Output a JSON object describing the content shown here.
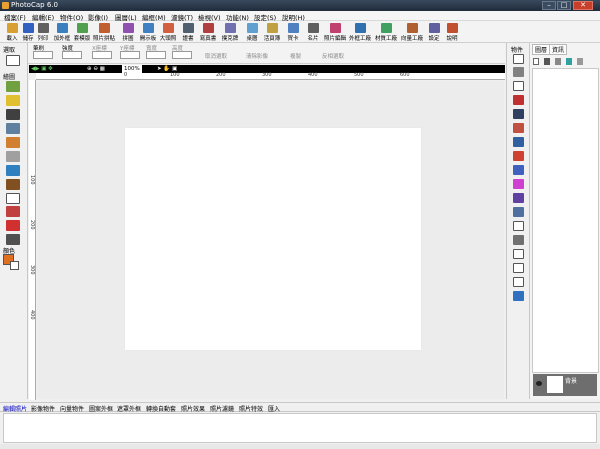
{
  "window": {
    "title": "PhotoCap 6.0",
    "minimize": "–",
    "maximize": "□",
    "close": "✕"
  },
  "menu": [
    "檔案(F)",
    "編輯(E)",
    "物件(O)",
    "影像(I)",
    "圖層(L)",
    "編框(M)",
    "濾鏡(T)",
    "檢視(V)",
    "功能(N)",
    "設定(S)",
    "說明(H)"
  ],
  "toolbar": [
    {
      "label": "載入",
      "color": "#d8a030"
    },
    {
      "label": "儲存",
      "color": "#3060c0"
    },
    {
      "label": "列印",
      "color": "#606060"
    },
    {
      "label": "加外框",
      "color": "#3a80c0"
    },
    {
      "label": "套模版",
      "color": "#50a050"
    },
    {
      "label": "照片拼貼",
      "color": "#c06030"
    },
    {
      "label": "拼圖",
      "color": "#9050b0"
    },
    {
      "label": "開示板",
      "color": "#4080c0"
    },
    {
      "label": "大頭照",
      "color": "#d06040"
    },
    {
      "label": "證書",
      "color": "#506070"
    },
    {
      "label": "寫真書",
      "color": "#b04040"
    },
    {
      "label": "撲克牌",
      "color": "#7070b0"
    },
    {
      "label": "桌曆",
      "color": "#60a0d0"
    },
    {
      "label": "活頁簿",
      "color": "#c0a040"
    },
    {
      "label": "賀卡",
      "color": "#5080c0"
    },
    {
      "label": "名片",
      "color": "#606060"
    },
    {
      "label": "照片編輯",
      "color": "#c04070"
    },
    {
      "label": "外框工廠",
      "color": "#3070b0"
    },
    {
      "label": "材質工廠",
      "color": "#40a060"
    },
    {
      "label": "向量工廠",
      "color": "#b06030"
    },
    {
      "label": "設定",
      "color": "#6060a0"
    },
    {
      "label": "說明",
      "color": "#c05030"
    }
  ],
  "options": {
    "groups": [
      "筆刷",
      "強度",
      "X座標",
      "Y座標",
      "寬度",
      "高度"
    ],
    "actions": [
      "取消選取",
      "清除影像",
      "複製",
      "反相選取"
    ]
  },
  "left_panel": {
    "select_header": "選取",
    "draw_header": "繪圖",
    "color_header": "顏色",
    "fg_color": "#e07020",
    "bg_color": "#ffffff"
  },
  "viewbar": {
    "zoom": "100%",
    "info": "1 / 1"
  },
  "ruler_h": [
    "0",
    "100",
    "200",
    "300",
    "400",
    "500",
    "600"
  ],
  "ruler_v": [
    "100",
    "200",
    "300",
    "400"
  ],
  "object_panel": {
    "header": "物件"
  },
  "right_panel": {
    "tab_layers": "圖層",
    "tab_info": "資訊",
    "layer_name": "背景"
  },
  "bottom_tabs": [
    "編輯照片",
    "影像物件",
    "向量物件",
    "圖案外框",
    "遮罩外框",
    "轉換自動套",
    "照片效果",
    "照片濾鏡",
    "照片特效",
    "匯入"
  ]
}
